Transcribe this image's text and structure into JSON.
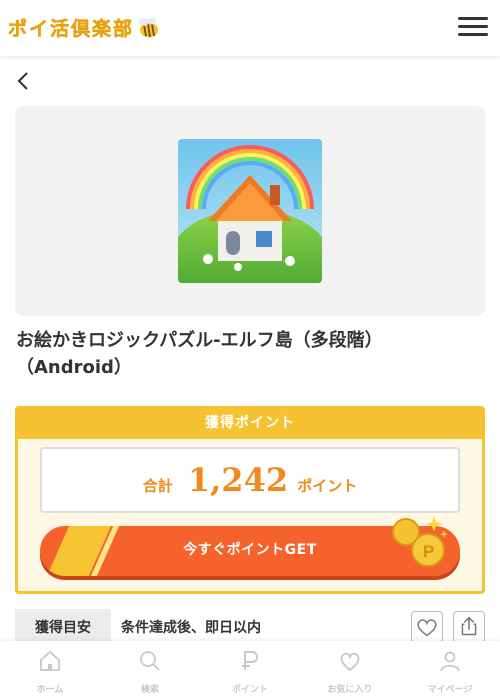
{
  "header": {
    "logo_text": "ポイ活倶楽部",
    "menu_icon": "hamburger-menu-icon"
  },
  "nav": {
    "back_icon": "chevron-left-icon"
  },
  "offer": {
    "title_line1": "お絵かきロジックパズル-エルフ島（多段階）",
    "title_line2": "（Android）"
  },
  "points": {
    "header": "獲得ポイント",
    "total_label": "合計",
    "total_value": "1,242",
    "unit": "ポイント",
    "get_button": "今すぐポイントGET"
  },
  "meta": {
    "label": "獲得目安",
    "value": "条件達成後、即日以内"
  },
  "bottom_nav": [
    {
      "label": "ホーム",
      "icon": "home-icon"
    },
    {
      "label": "検索",
      "icon": "search-icon"
    },
    {
      "label": "ポイント",
      "icon": "point-p-icon"
    },
    {
      "label": "お気に入り",
      "icon": "heart-icon"
    },
    {
      "label": "マイページ",
      "icon": "person-icon"
    }
  ],
  "colors": {
    "accent_yellow": "#f5c331",
    "button_orange": "#f5622c",
    "point_orange": "#f08a1c"
  }
}
